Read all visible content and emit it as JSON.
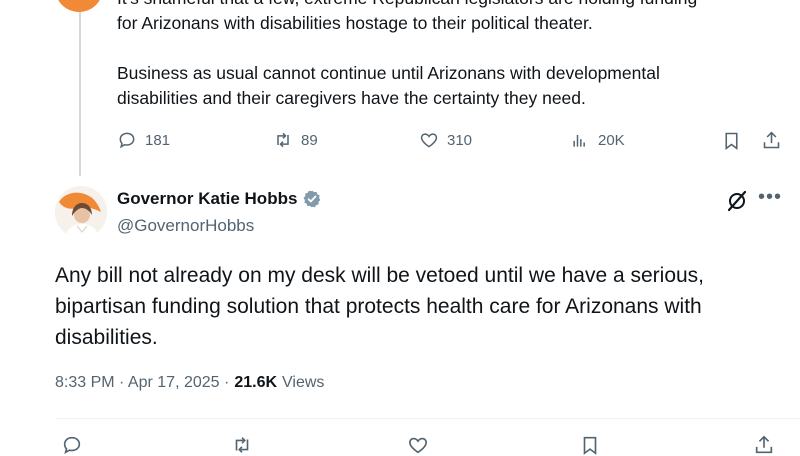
{
  "previous_tweet": {
    "line1": "It's shameful that a few, extreme Republican legislators are holding funding",
    "line2": "for Arizonans with disabilities hostage to their political theater.",
    "para2_line1": "Business as usual cannot continue until Arizonans with developmental",
    "para2_line2": "disabilities and their caregivers have the certainty they need.",
    "actions": {
      "replies": "181",
      "reposts": "89",
      "likes": "310",
      "views": "20K"
    }
  },
  "tweet": {
    "author_name": "Governor Katie Hobbs",
    "handle": "@GovernorHobbs",
    "text": "Any bill not already on my desk will be vetoed until we have a serious, bipartisan funding solution that protects health care for Arizonans with disabilities.",
    "time": "8:33 PM · Apr 17, 2025 ·",
    "views_count": "21.6K",
    "views_label": "Views"
  },
  "colors": {
    "text": "#0f1419",
    "muted": "#536471",
    "verified_badge": "#829aab",
    "accent_orange": "#f08a36"
  },
  "icons": [
    "reply-icon",
    "repost-icon",
    "like-icon",
    "views-icon",
    "bookmark-icon",
    "share-icon",
    "grok-icon",
    "more-icon",
    "verified-icon"
  ]
}
